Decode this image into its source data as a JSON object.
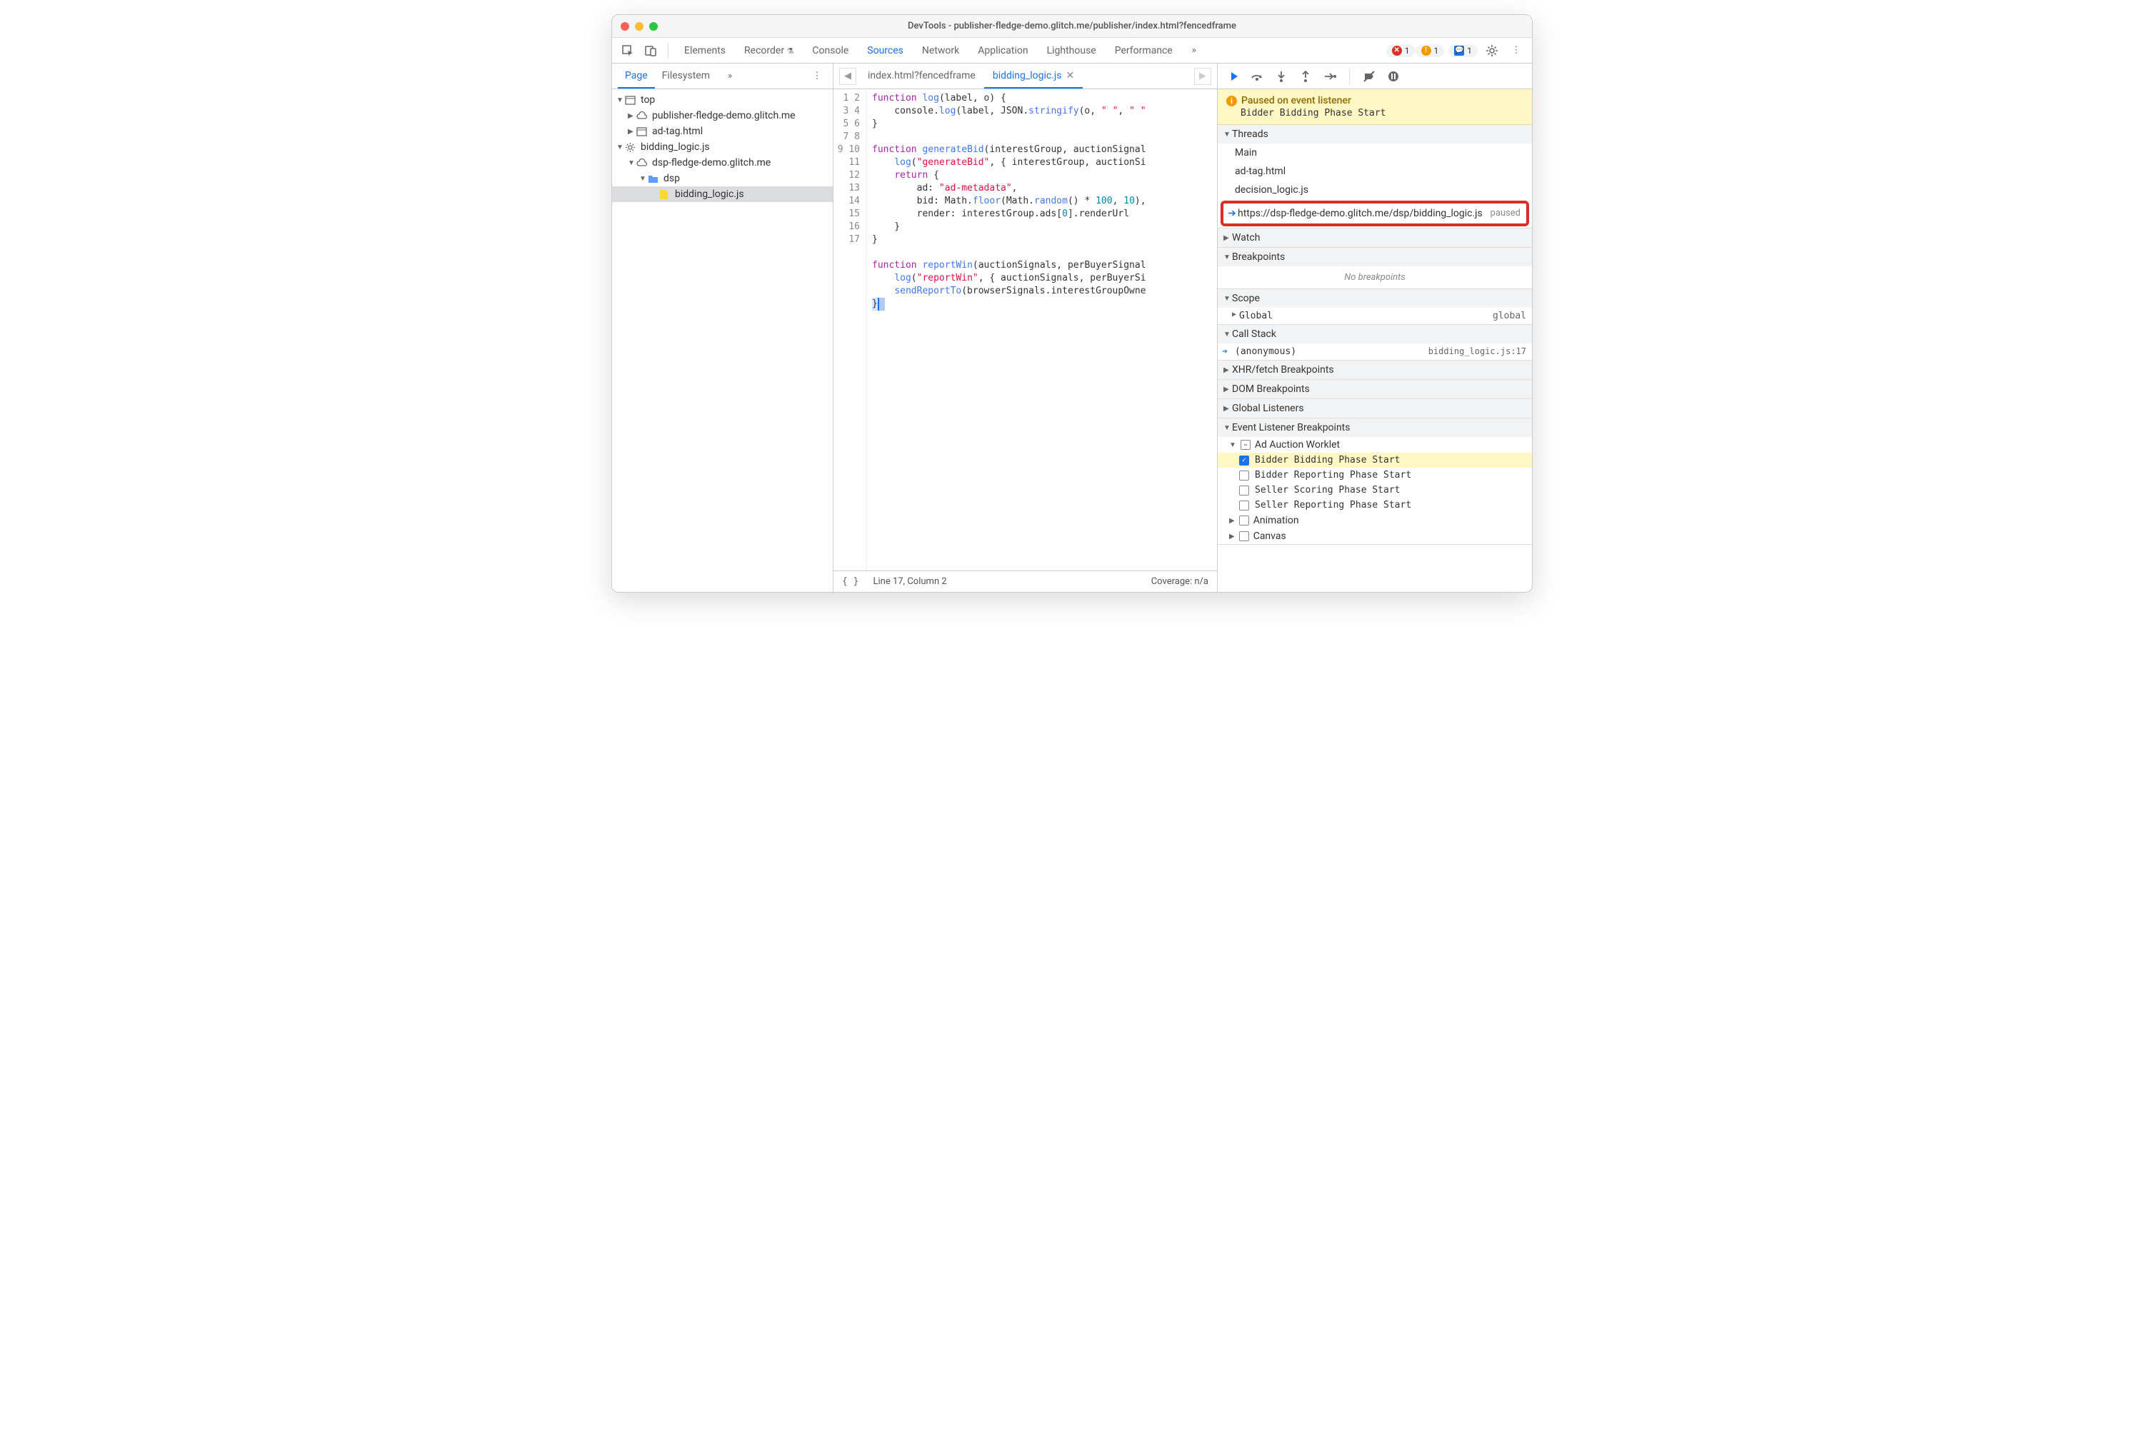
{
  "window": {
    "title": "DevTools - publisher-fledge-demo.glitch.me/publisher/index.html?fencedframe"
  },
  "mainTabs": [
    "Elements",
    "Recorder",
    "Console",
    "Sources",
    "Network",
    "Application",
    "Lighthouse",
    "Performance"
  ],
  "activeMainTab": "Sources",
  "badges": {
    "errors": "1",
    "warnings": "1",
    "issues": "1"
  },
  "leftTabs": [
    "Page",
    "Filesystem"
  ],
  "activeLeftTab": "Page",
  "tree": [
    {
      "label": "top",
      "indent": 0,
      "icon": "frame",
      "arrow": "▼"
    },
    {
      "label": "publisher-fledge-demo.glitch.me",
      "indent": 1,
      "icon": "cloud",
      "arrow": "▶"
    },
    {
      "label": "ad-tag.html",
      "indent": 1,
      "icon": "frame",
      "arrow": "▶"
    },
    {
      "label": "bidding_logic.js",
      "indent": 0,
      "icon": "worker",
      "arrow": "▼"
    },
    {
      "label": "dsp-fledge-demo.glitch.me",
      "indent": 1,
      "icon": "cloud",
      "arrow": "▼"
    },
    {
      "label": "dsp",
      "indent": 2,
      "icon": "folder",
      "arrow": "▼"
    },
    {
      "label": "bidding_logic.js",
      "indent": 3,
      "icon": "jsfile",
      "arrow": "",
      "selected": true
    }
  ],
  "fileTabs": [
    {
      "label": "index.html?fencedframe",
      "active": false,
      "close": false
    },
    {
      "label": "bidding_logic.js",
      "active": true,
      "close": true
    }
  ],
  "editorLines": 17,
  "status": {
    "pos": "Line 17, Column 2",
    "coverage": "Coverage: n/a"
  },
  "pauseBanner": {
    "title": "Paused on event listener",
    "detail": "Bidder Bidding Phase Start"
  },
  "threads": {
    "title": "Threads",
    "items": [
      "Main",
      "ad-tag.html",
      "decision_logic.js"
    ],
    "highlighted": {
      "label": "https://dsp-fledge-demo.glitch.me/dsp/bidding_logic.js",
      "status": "paused"
    }
  },
  "sections": {
    "watch": "Watch",
    "breakpoints": {
      "title": "Breakpoints",
      "empty": "No breakpoints"
    },
    "scope": {
      "title": "Scope",
      "global": {
        "label": "Global",
        "value": "global"
      }
    },
    "callstack": {
      "title": "Call Stack",
      "frame": {
        "name": "(anonymous)",
        "loc": "bidding_logic.js:17"
      }
    },
    "xhr": "XHR/fetch Breakpoints",
    "dom": "DOM Breakpoints",
    "listeners": "Global Listeners",
    "events": {
      "title": "Event Listener Breakpoints",
      "group": "Ad Auction Worklet",
      "items": [
        {
          "label": "Bidder Bidding Phase Start",
          "checked": true,
          "hl": true
        },
        {
          "label": "Bidder Reporting Phase Start",
          "checked": false
        },
        {
          "label": "Seller Scoring Phase Start",
          "checked": false
        },
        {
          "label": "Seller Reporting Phase Start",
          "checked": false
        }
      ],
      "after": [
        "Animation",
        "Canvas"
      ]
    }
  }
}
